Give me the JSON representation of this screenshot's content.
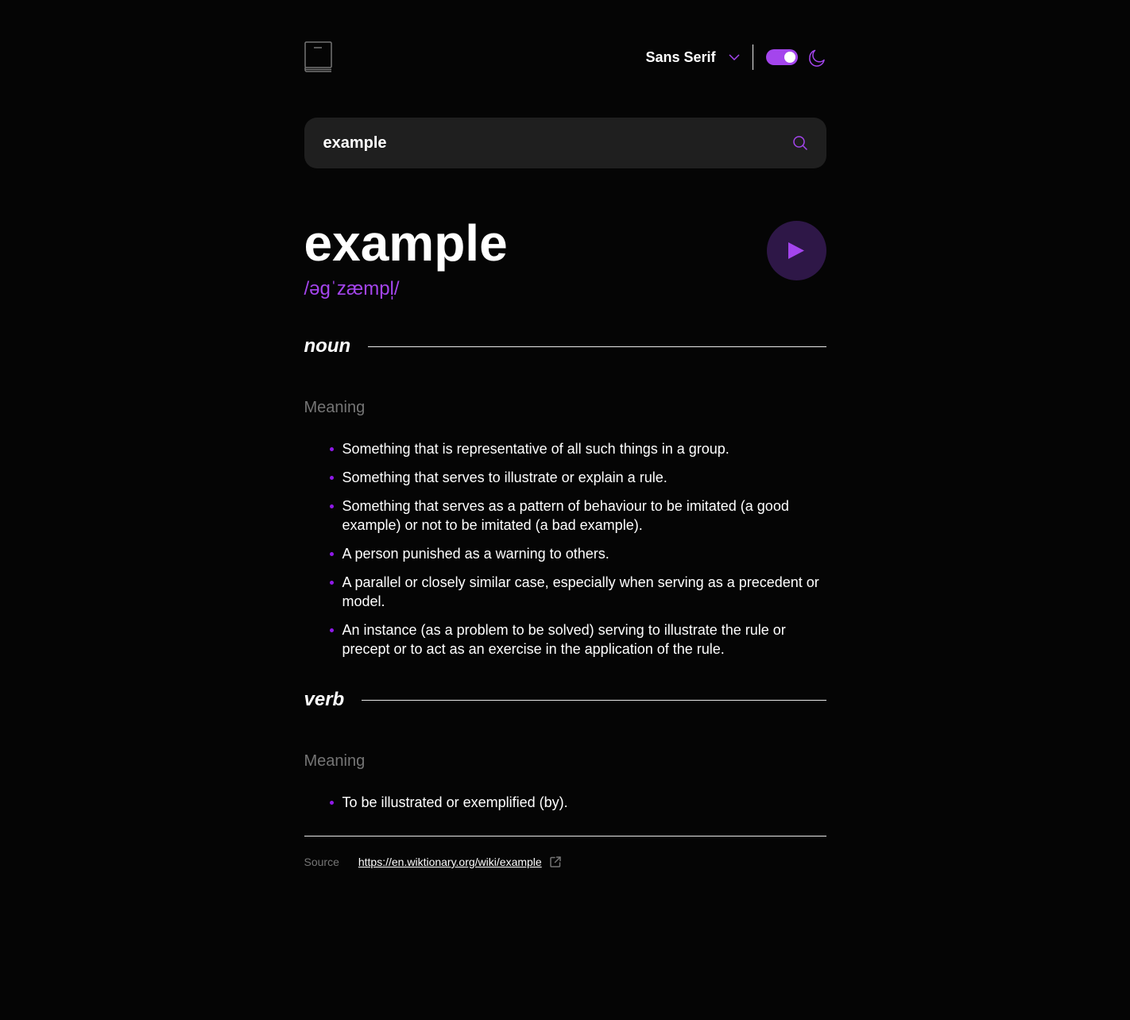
{
  "header": {
    "font_selector": "Sans Serif",
    "theme_toggle_on": true,
    "accent_color": "#a445ed",
    "logo_icon": "book-icon",
    "dropdown_icon": "chevron-down-icon",
    "theme_icon": "moon-icon"
  },
  "search": {
    "value": "example",
    "icon": "search-icon"
  },
  "entry": {
    "word": "example",
    "phonetic": "/əɡˈzæmpl̩/",
    "play_icon": "play-icon"
  },
  "meanings": [
    {
      "part_of_speech": "noun",
      "meaning_label": "Meaning",
      "definitions": [
        "Something that is representative of all such things in a group.",
        "Something that serves to illustrate or explain a rule.",
        "Something that serves as a pattern of behaviour to be imitated (a good example) or not to be imitated (a bad example).",
        "A person punished as a warning to others.",
        "A parallel or closely similar case, especially when serving as a precedent or model.",
        "An instance (as a problem to be solved) serving to illustrate the rule or precept or to act as an exercise in the application of the rule."
      ]
    },
    {
      "part_of_speech": "verb",
      "meaning_label": "Meaning",
      "definitions": [
        "To be illustrated or exemplified (by)."
      ]
    }
  ],
  "source": {
    "label": "Source",
    "url": "https://en.wiktionary.org/wiki/example",
    "icon": "external-link-icon"
  }
}
